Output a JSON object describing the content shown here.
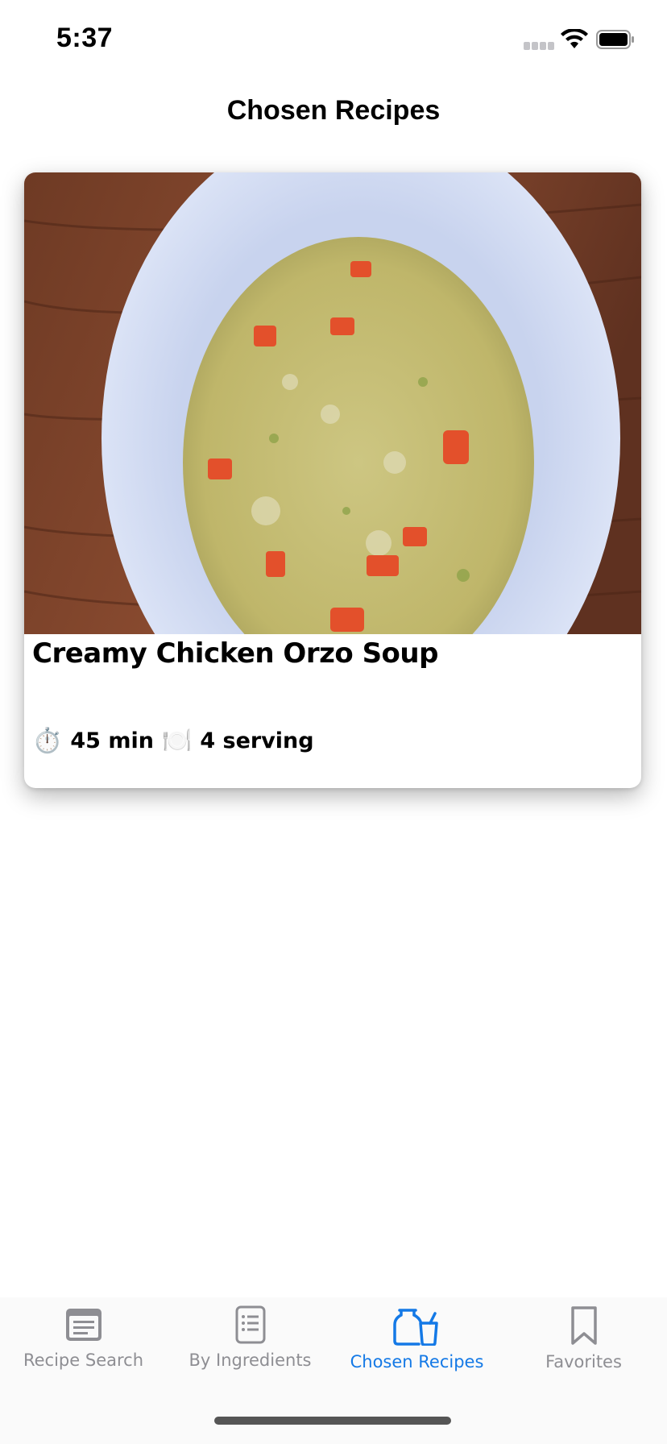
{
  "status_bar": {
    "time": "5:37"
  },
  "nav": {
    "title": "Chosen Recipes"
  },
  "recipe": {
    "title": "Creamy Chicken Orzo Soup",
    "time_icon": "⏱️",
    "time": "45 min",
    "serving_icon": "🍽️",
    "servings": "4 serving"
  },
  "tabs": [
    {
      "label": "Recipe Search",
      "icon": "newspaper-icon"
    },
    {
      "label": "By Ingredients",
      "icon": "list-icon"
    },
    {
      "label": "Chosen Recipes",
      "icon": "jars-icon",
      "active": true
    },
    {
      "label": "Favorites",
      "icon": "bookmark-icon"
    }
  ],
  "colors": {
    "accent": "#1479e6",
    "inactive": "#8e8e93"
  }
}
